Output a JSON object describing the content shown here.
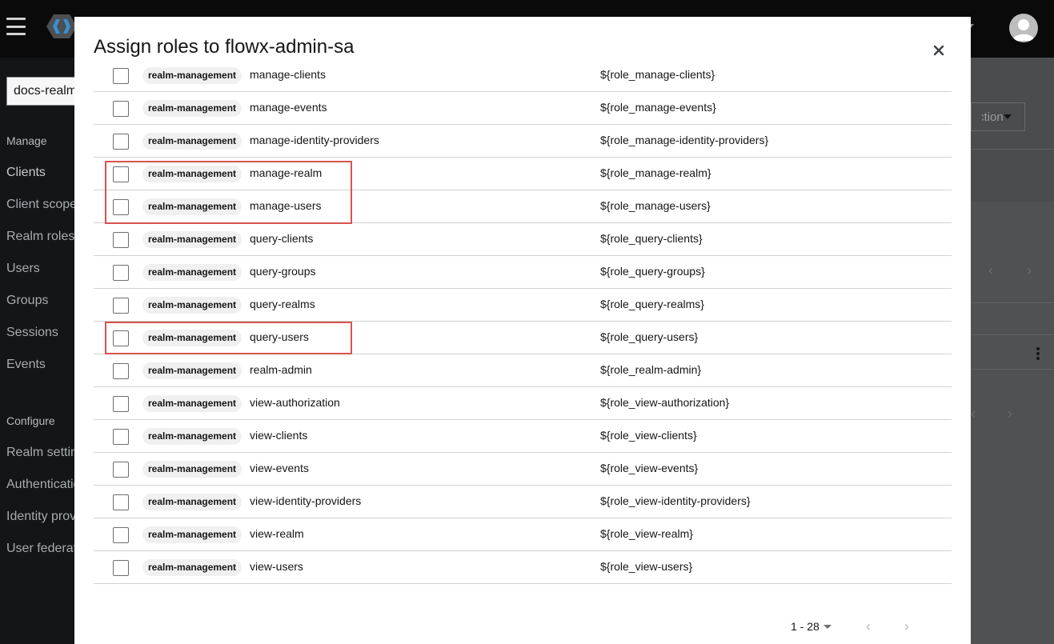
{
  "app": {
    "realm_selector": "docs-realm",
    "nav": {
      "manage_section": "Manage",
      "configure_section": "Configure",
      "manage_items": [
        "Clients",
        "Client scopes",
        "Realm roles",
        "Users",
        "Groups",
        "Sessions",
        "Events"
      ],
      "configure_items": [
        "Realm settings",
        "Authentication",
        "Identity providers",
        "User federation"
      ]
    },
    "background_dropdown": "Action"
  },
  "modal": {
    "title": "Assign roles to flowx-admin-sa",
    "close_label": "×",
    "highlight_color": "#d9534f",
    "rows": [
      {
        "client": "realm-management",
        "role": "manage-clients",
        "description": "${role_manage-clients}"
      },
      {
        "client": "realm-management",
        "role": "manage-events",
        "description": "${role_manage-events}"
      },
      {
        "client": "realm-management",
        "role": "manage-identity-providers",
        "description": "${role_manage-identity-providers}"
      },
      {
        "client": "realm-management",
        "role": "manage-realm",
        "description": "${role_manage-realm}"
      },
      {
        "client": "realm-management",
        "role": "manage-users",
        "description": "${role_manage-users}"
      },
      {
        "client": "realm-management",
        "role": "query-clients",
        "description": "${role_query-clients}"
      },
      {
        "client": "realm-management",
        "role": "query-groups",
        "description": "${role_query-groups}"
      },
      {
        "client": "realm-management",
        "role": "query-realms",
        "description": "${role_query-realms}"
      },
      {
        "client": "realm-management",
        "role": "query-users",
        "description": "${role_query-users}"
      },
      {
        "client": "realm-management",
        "role": "realm-admin",
        "description": "${role_realm-admin}"
      },
      {
        "client": "realm-management",
        "role": "view-authorization",
        "description": "${role_view-authorization}"
      },
      {
        "client": "realm-management",
        "role": "view-clients",
        "description": "${role_view-clients}"
      },
      {
        "client": "realm-management",
        "role": "view-events",
        "description": "${role_view-events}"
      },
      {
        "client": "realm-management",
        "role": "view-identity-providers",
        "description": "${role_view-identity-providers}"
      },
      {
        "client": "realm-management",
        "role": "view-realm",
        "description": "${role_view-realm}"
      },
      {
        "client": "realm-management",
        "role": "view-users",
        "description": "${role_view-users}"
      }
    ],
    "pagination": {
      "range": "1 - 28",
      "prev_label": "‹",
      "next_label": "›"
    }
  }
}
